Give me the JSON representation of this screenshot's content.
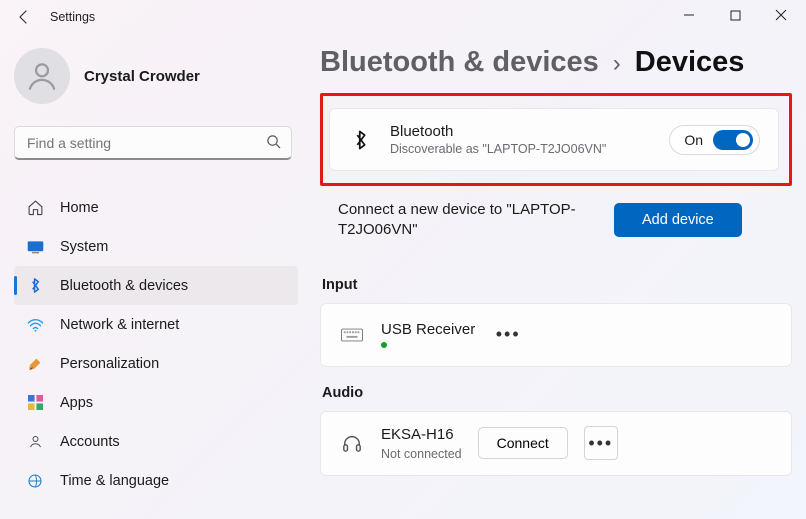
{
  "app": {
    "title": "Settings"
  },
  "user": {
    "name": "Crystal Crowder"
  },
  "search": {
    "placeholder": "Find a setting"
  },
  "nav": {
    "items": [
      {
        "label": "Home"
      },
      {
        "label": "System"
      },
      {
        "label": "Bluetooth & devices"
      },
      {
        "label": "Network & internet"
      },
      {
        "label": "Personalization"
      },
      {
        "label": "Apps"
      },
      {
        "label": "Accounts"
      },
      {
        "label": "Time & language"
      }
    ],
    "active_index": 2
  },
  "breadcrumb": {
    "parent": "Bluetooth & devices",
    "sep": "›",
    "current": "Devices"
  },
  "bluetooth": {
    "title": "Bluetooth",
    "subtitle": "Discoverable as \"LAPTOP-T2JO06VN\"",
    "toggle_state": "On"
  },
  "connect": {
    "text": "Connect a new device to \"LAPTOP-T2JO06VN\"",
    "button": "Add device"
  },
  "sections": {
    "input": "Input",
    "audio": "Audio"
  },
  "input_device": {
    "name": "USB Receiver"
  },
  "audio_device": {
    "name": "EKSA-H16",
    "status": "Not connected",
    "action": "Connect"
  }
}
